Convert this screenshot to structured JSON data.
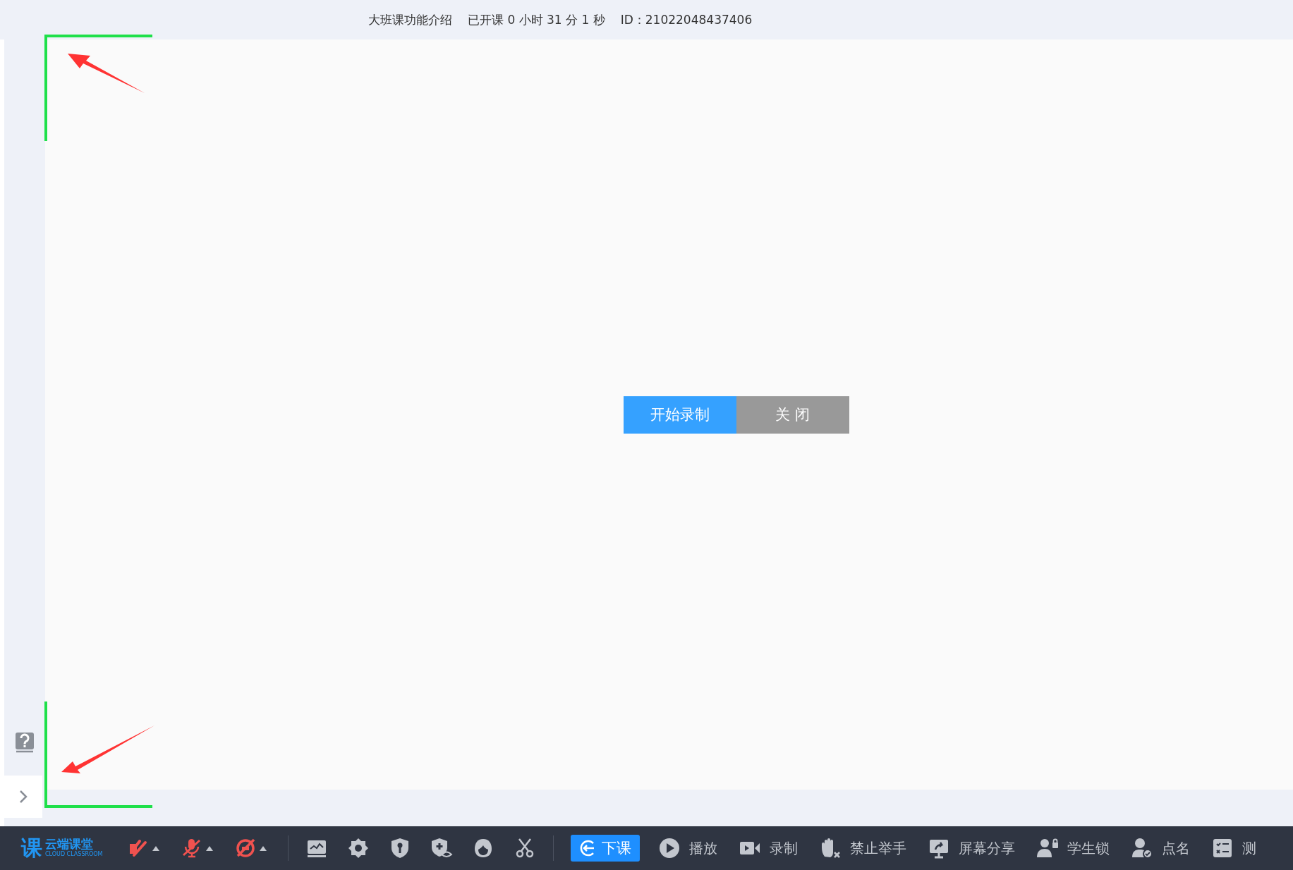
{
  "header": {
    "course": "大班课功能介绍",
    "elapsed": "已开课 0 小时 31 分 1 秒",
    "id": "ID：21022048437406"
  },
  "dialog": {
    "buttons": [
      {
        "label": "开始录制",
        "kind": "primary"
      },
      {
        "label": "关 闭",
        "kind": "secondary"
      }
    ]
  },
  "toolbar": {
    "logo": {
      "mark": "课",
      "name": "云端课堂",
      "subtitle": "CLOUD CLASSROOM"
    },
    "media": [
      {
        "kind": "camera",
        "muted": true
      },
      {
        "kind": "microphone",
        "muted": true
      },
      {
        "kind": "speaker",
        "muted": true
      }
    ],
    "tools": [
      {
        "kind": "whiteboard"
      },
      {
        "kind": "settings"
      },
      {
        "kind": "key-shield"
      },
      {
        "kind": "eye-shield"
      },
      {
        "kind": "face"
      },
      {
        "kind": "scissors"
      }
    ],
    "end_button": "下课",
    "actions": [
      {
        "kind": "play",
        "label": "播放"
      },
      {
        "kind": "record",
        "label": "录制"
      },
      {
        "kind": "hand",
        "label": "禁止举手"
      },
      {
        "kind": "screen",
        "label": "屏幕分享"
      },
      {
        "kind": "lock",
        "label": "学生锁"
      },
      {
        "kind": "rollcall",
        "label": "点名"
      },
      {
        "kind": "quiz",
        "label": "测"
      }
    ]
  }
}
